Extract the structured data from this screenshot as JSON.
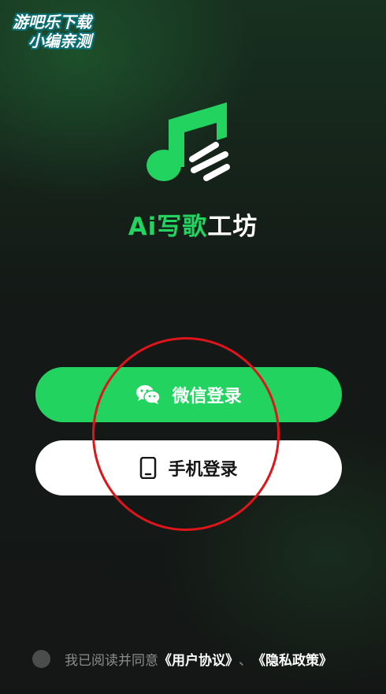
{
  "watermark": {
    "line1": "游吧乐下载",
    "line2": "小编亲测"
  },
  "app": {
    "name_prefix": "Ai写歌",
    "name_suffix": "工坊"
  },
  "buttons": {
    "wechat": {
      "label": "微信登录",
      "icon": "wechat-icon"
    },
    "phone": {
      "label": "手机登录",
      "icon": "phone-icon"
    }
  },
  "agreement": {
    "prefix": "我已阅读并同意",
    "user_agreement": "《用户协议》",
    "separator": "、",
    "privacy_policy": "《隐私政策》"
  },
  "colors": {
    "accent_green": "#22d35f",
    "annotation_red": "#e0151a"
  }
}
